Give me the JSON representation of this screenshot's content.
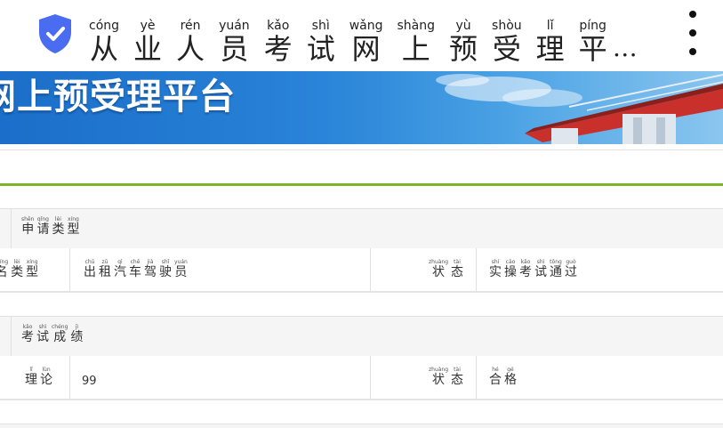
{
  "header": {
    "title_chars": [
      {
        "char": "从",
        "pinyin": "cóng"
      },
      {
        "char": "业",
        "pinyin": "yè"
      },
      {
        "char": "人",
        "pinyin": "rén"
      },
      {
        "char": "员",
        "pinyin": "yuán"
      },
      {
        "char": "考",
        "pinyin": "kǎo"
      },
      {
        "char": "试",
        "pinyin": "shì"
      },
      {
        "char": "网",
        "pinyin": "wǎng"
      },
      {
        "char": "上",
        "pinyin": "shàng"
      },
      {
        "char": "预",
        "pinyin": "yù"
      },
      {
        "char": "受",
        "pinyin": "shòu"
      },
      {
        "char": "理",
        "pinyin": "lǐ"
      },
      {
        "char": "平",
        "pinyin": "píng"
      }
    ],
    "ellipsis": "…",
    "menu_icon": "more-vertical-icon",
    "shield_icon": "verified-shield-icon",
    "shield_color": "#4a6cf0"
  },
  "banner": {
    "text": "网上预受理平台"
  },
  "accent_color": "#79b52b",
  "sections": {
    "application": {
      "heading": [
        {
          "char": "申",
          "pinyin": "shēn"
        },
        {
          "char": "请",
          "pinyin": "qǐng"
        },
        {
          "char": "类",
          "pinyin": "lèi"
        },
        {
          "char": "型",
          "pinyin": "xíng"
        }
      ],
      "row": {
        "label": [
          {
            "char": "名",
            "pinyin": "míng"
          },
          {
            "char": "类",
            "pinyin": "lèi"
          },
          {
            "char": "型",
            "pinyin": "xíng"
          }
        ],
        "value": [
          {
            "char": "出",
            "pinyin": "chū"
          },
          {
            "char": "租",
            "pinyin": "zū"
          },
          {
            "char": "汽",
            "pinyin": "qì"
          },
          {
            "char": "车",
            "pinyin": "chē"
          },
          {
            "char": "驾",
            "pinyin": "jià"
          },
          {
            "char": "驶",
            "pinyin": "shǐ"
          },
          {
            "char": "员",
            "pinyin": "yuán"
          }
        ],
        "status_label": [
          {
            "char": "状",
            "pinyin": "zhuàng"
          },
          {
            "char": "态",
            "pinyin": "tài"
          }
        ],
        "status_value": [
          {
            "char": "实",
            "pinyin": "shí"
          },
          {
            "char": "操",
            "pinyin": "cāo"
          },
          {
            "char": "考",
            "pinyin": "kǎo"
          },
          {
            "char": "试",
            "pinyin": "shì"
          },
          {
            "char": "通",
            "pinyin": "tōng"
          },
          {
            "char": "过",
            "pinyin": "guò"
          }
        ]
      }
    },
    "results": {
      "heading": [
        {
          "char": "考",
          "pinyin": "kǎo"
        },
        {
          "char": "试",
          "pinyin": "shì"
        },
        {
          "char": "成",
          "pinyin": "chéng"
        },
        {
          "char": "绩",
          "pinyin": "jì"
        }
      ],
      "row": {
        "label": [
          {
            "char": "理",
            "pinyin": "lǐ"
          },
          {
            "char": "论",
            "pinyin": "lùn"
          }
        ],
        "score": "99",
        "status_label": [
          {
            "char": "状",
            "pinyin": "zhuàng"
          },
          {
            "char": "态",
            "pinyin": "tài"
          }
        ],
        "status_value": [
          {
            "char": "合",
            "pinyin": "hé"
          },
          {
            "char": "格",
            "pinyin": "gé"
          }
        ]
      }
    }
  }
}
